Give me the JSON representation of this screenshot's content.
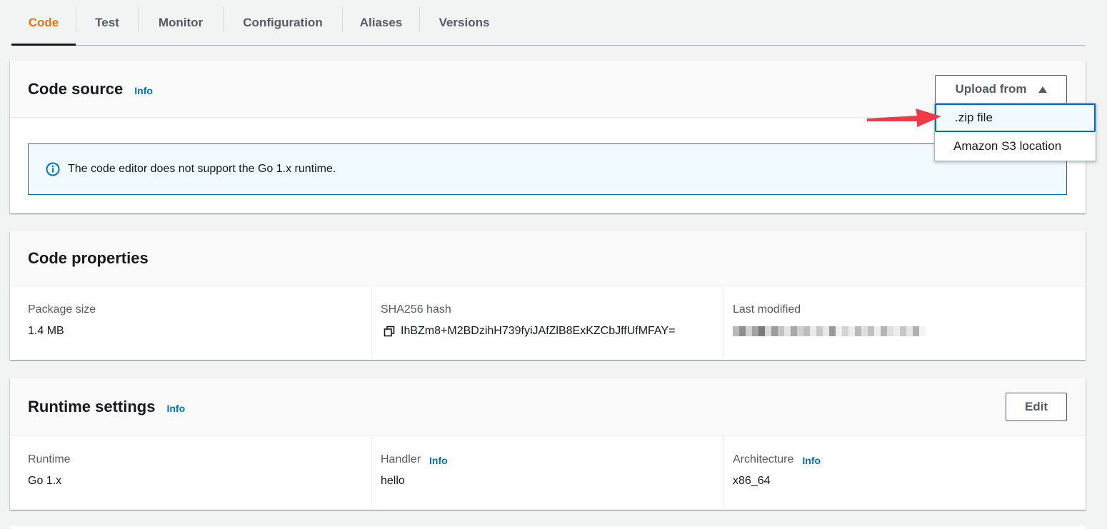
{
  "tabs": [
    {
      "label": "Code",
      "active": true
    },
    {
      "label": "Test",
      "active": false
    },
    {
      "label": "Monitor",
      "active": false
    },
    {
      "label": "Configuration",
      "active": false
    },
    {
      "label": "Aliases",
      "active": false
    },
    {
      "label": "Versions",
      "active": false
    }
  ],
  "code_source": {
    "title": "Code source",
    "info_label": "Info",
    "upload_button_label": "Upload from",
    "dropdown": {
      "items": [
        ".zip file",
        "Amazon S3 location"
      ],
      "highlighted_index": 0
    },
    "alert_text": "The code editor does not support the Go 1.x runtime."
  },
  "code_properties": {
    "title": "Code properties",
    "package_size": {
      "label": "Package size",
      "value": "1.4 MB"
    },
    "sha256": {
      "label": "SHA256 hash",
      "value": "IhBZm8+M2BDzihH739fyiJAfZlB8ExKZCbJffUfMFAY="
    },
    "last_modified": {
      "label": "Last modified"
    }
  },
  "runtime_settings": {
    "title": "Runtime settings",
    "info_label": "Info",
    "edit_button_label": "Edit",
    "runtime": {
      "label": "Runtime",
      "value": "Go 1.x"
    },
    "handler": {
      "label": "Handler",
      "info_label": "Info",
      "value": "hello"
    },
    "architecture": {
      "label": "Architecture",
      "info_label": "Info",
      "value": "x86_64"
    }
  },
  "colors": {
    "active_tab": "#ec7211",
    "link": "#0073bb",
    "annotation_arrow": "#f03a47"
  }
}
